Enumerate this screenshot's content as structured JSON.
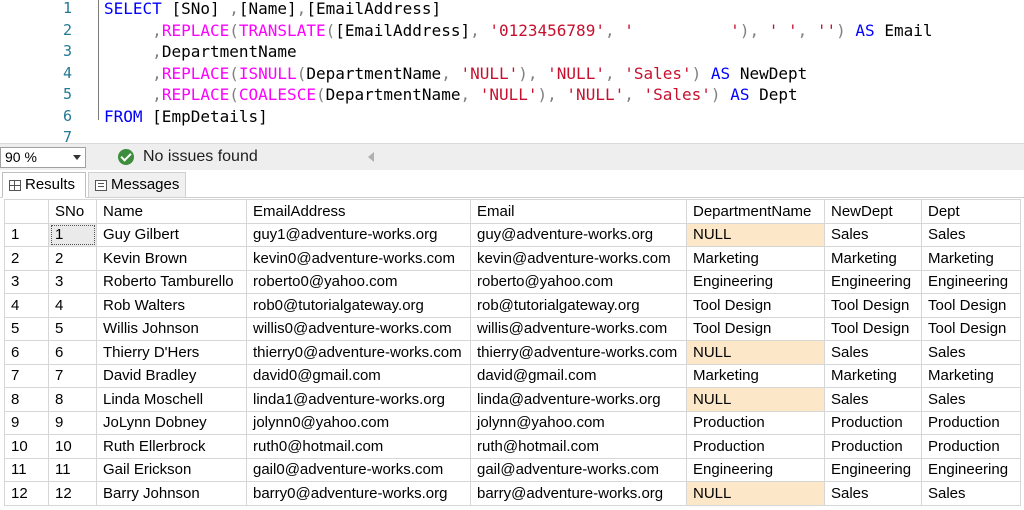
{
  "editor": {
    "line_numbers": [
      "1",
      "2",
      "3",
      "4",
      "5",
      "6",
      "7"
    ],
    "lines": [
      [
        [
          "kw",
          "SELECT "
        ],
        [
          "",
          "[SNo] "
        ],
        [
          "gr",
          ","
        ],
        [
          "",
          "[Name]"
        ],
        [
          "gr",
          ","
        ],
        [
          "",
          "[EmailAddress]"
        ]
      ],
      [
        [
          "",
          "     "
        ],
        [
          "gr",
          ","
        ],
        [
          "fn",
          "REPLACE"
        ],
        [
          "gr",
          "("
        ],
        [
          "fn",
          "TRANSLATE"
        ],
        [
          "gr",
          "("
        ],
        [
          "",
          "[EmailAddress]"
        ],
        [
          "gr",
          ", "
        ],
        [
          "str",
          "'0123456789'"
        ],
        [
          "gr",
          ", "
        ],
        [
          "str",
          "'          '"
        ],
        [
          "gr",
          "), "
        ],
        [
          "str",
          "' '"
        ],
        [
          "gr",
          ", "
        ],
        [
          "str",
          "''"
        ],
        [
          "gr",
          ") "
        ],
        [
          "kw",
          "AS "
        ],
        [
          "",
          "Email"
        ]
      ],
      [
        [
          "",
          "     "
        ],
        [
          "gr",
          ","
        ],
        [
          "",
          "DepartmentName"
        ]
      ],
      [
        [
          "",
          "     "
        ],
        [
          "gr",
          ","
        ],
        [
          "fn",
          "REPLACE"
        ],
        [
          "gr",
          "("
        ],
        [
          "fn",
          "ISNULL"
        ],
        [
          "gr",
          "("
        ],
        [
          "",
          "DepartmentName"
        ],
        [
          "gr",
          ", "
        ],
        [
          "str",
          "'NULL'"
        ],
        [
          "gr",
          "), "
        ],
        [
          "str",
          "'NULL'"
        ],
        [
          "gr",
          ", "
        ],
        [
          "str",
          "'Sales'"
        ],
        [
          "gr",
          ") "
        ],
        [
          "kw",
          "AS "
        ],
        [
          "",
          "NewDept"
        ]
      ],
      [
        [
          "",
          "     "
        ],
        [
          "gr",
          ","
        ],
        [
          "fn",
          "REPLACE"
        ],
        [
          "gr",
          "("
        ],
        [
          "fn",
          "COALESCE"
        ],
        [
          "gr",
          "("
        ],
        [
          "",
          "DepartmentName"
        ],
        [
          "gr",
          ", "
        ],
        [
          "str",
          "'NULL'"
        ],
        [
          "gr",
          "), "
        ],
        [
          "str",
          "'NULL'"
        ],
        [
          "gr",
          ", "
        ],
        [
          "str",
          "'Sales'"
        ],
        [
          "gr",
          ") "
        ],
        [
          "kw",
          "AS "
        ],
        [
          "",
          "Dept"
        ]
      ],
      [
        [
          "kw",
          "FROM "
        ],
        [
          "",
          "[EmpDetails]"
        ]
      ],
      []
    ]
  },
  "status": {
    "zoom": "90 %",
    "issues": "No issues found"
  },
  "tabs": {
    "results": "Results",
    "messages": "Messages"
  },
  "grid": {
    "columns": [
      "",
      "SNo",
      "Name",
      "EmailAddress",
      "Email",
      "DepartmentName",
      "NewDept",
      "Dept"
    ],
    "null_color": "#fce8c8",
    "rows": [
      [
        "1",
        "1",
        "Guy Gilbert",
        "guy1@adventure-works.org",
        "guy@adventure-works.org",
        "NULL",
        "Sales",
        "Sales"
      ],
      [
        "2",
        "2",
        "Kevin Brown",
        "kevin0@adventure-works.com",
        "kevin@adventure-works.com",
        "Marketing",
        "Marketing",
        "Marketing"
      ],
      [
        "3",
        "3",
        "Roberto Tamburello",
        "roberto0@yahoo.com",
        "roberto@yahoo.com",
        "Engineering",
        "Engineering",
        "Engineering"
      ],
      [
        "4",
        "4",
        "Rob Walters",
        "rob0@tutorialgateway.org",
        "rob@tutorialgateway.org",
        "Tool Design",
        "Tool Design",
        "Tool Design"
      ],
      [
        "5",
        "5",
        "Willis Johnson",
        "willis0@adventure-works.com",
        "willis@adventure-works.com",
        "Tool Design",
        "Tool Design",
        "Tool Design"
      ],
      [
        "6",
        "6",
        "Thierry D'Hers",
        "thierry0@adventure-works.com",
        "thierry@adventure-works.com",
        "NULL",
        "Sales",
        "Sales"
      ],
      [
        "7",
        "7",
        "David Bradley",
        "david0@gmail.com",
        "david@gmail.com",
        "Marketing",
        "Marketing",
        "Marketing"
      ],
      [
        "8",
        "8",
        "Linda Moschell",
        "linda1@adventure-works.org",
        "linda@adventure-works.org",
        "NULL",
        "Sales",
        "Sales"
      ],
      [
        "9",
        "9",
        "JoLynn Dobney",
        "jolynn0@yahoo.com",
        "jolynn@yahoo.com",
        "Production",
        "Production",
        "Production"
      ],
      [
        "10",
        "10",
        "Ruth Ellerbrock",
        "ruth0@hotmail.com",
        "ruth@hotmail.com",
        "Production",
        "Production",
        "Production"
      ],
      [
        "11",
        "11",
        "Gail Erickson",
        "gail0@adventure-works.com",
        "gail@adventure-works.com",
        "Engineering",
        "Engineering",
        "Engineering"
      ],
      [
        "12",
        "12",
        "Barry Johnson",
        "barry0@adventure-works.org",
        "barry@adventure-works.org",
        "NULL",
        "Sales",
        "Sales"
      ]
    ]
  }
}
